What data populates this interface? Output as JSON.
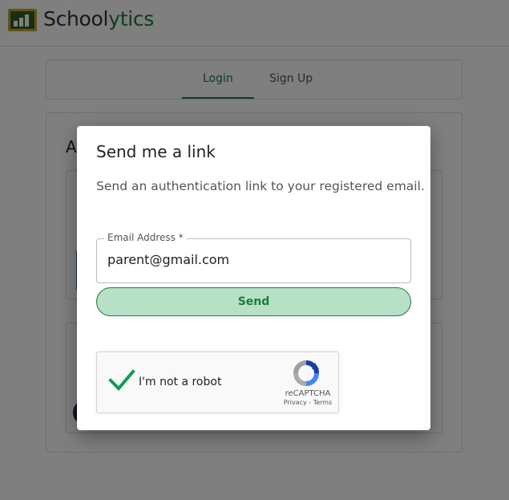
{
  "app": {
    "brand_prefix": "School",
    "brand_suffix": "ytics"
  },
  "tabs": [
    {
      "label": "Login",
      "active": true
    },
    {
      "label": "Sign Up",
      "active": false
    }
  ],
  "main": {
    "heading_initial": "A"
  },
  "dialog": {
    "title": "Send me a link",
    "description": "Send an authentication link to your registered email.",
    "email_label": "Email Address *",
    "email_value": "parent@gmail.com",
    "send_label": "Send"
  },
  "recaptcha": {
    "checkbox_label": "I'm not a robot",
    "checked": true,
    "brand": "reCAPTCHA",
    "terms": "Privacy - Terms"
  },
  "colors": {
    "brand_green": "#1f7a3f",
    "send_bg": "#b6e1c6",
    "check_green": "#0f9d58"
  },
  "icons": [
    "schoolytics-logo-icon",
    "checkmark-icon",
    "recaptcha-logo-icon"
  ]
}
